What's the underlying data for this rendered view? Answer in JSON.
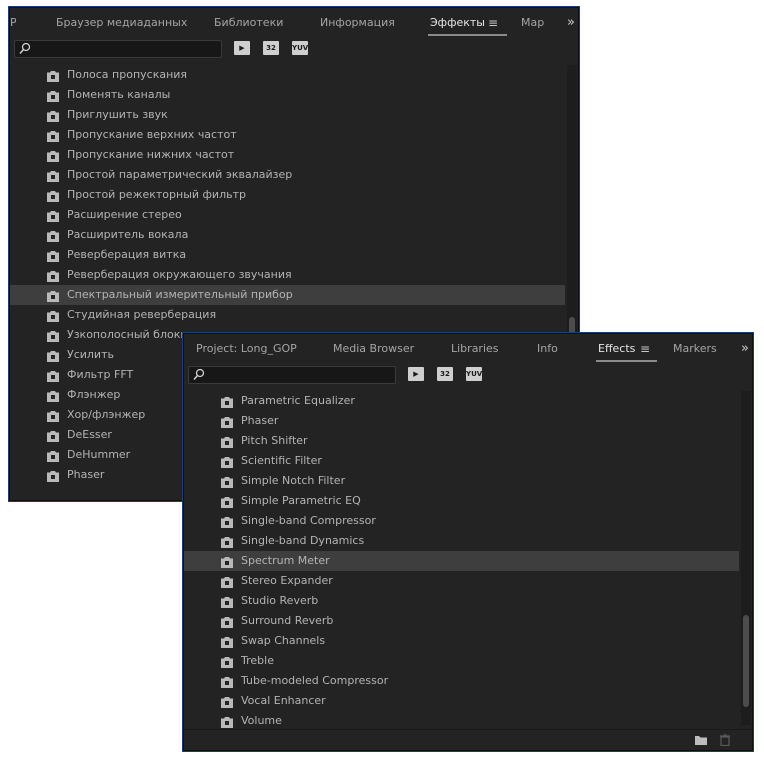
{
  "ru_panel": {
    "tabs": [
      {
        "label": "Браузер медиаданных"
      },
      {
        "label": "Библиотеки"
      },
      {
        "label": "Информация"
      },
      {
        "label": "Эффекты"
      },
      {
        "label": "Мар"
      }
    ],
    "menu_glyph": "≡",
    "overflow_glyph": "»",
    "left_clip": "Р",
    "toolbar": {
      "icon1": "▶",
      "icon2": "32",
      "icon3": "YUV",
      "search_value": "",
      "search_placeholder": ""
    },
    "items": [
      "Полоса пропускания",
      "Поменять каналы",
      "Приглушить звук",
      "Пропускание верхних частот",
      "Пропускание нижних частот",
      "Простой параметрический эквалайзер",
      "Простой режекторный фильтр",
      "Расширение стерео",
      "Расширитель вокала",
      "Реверберация витка",
      "Реверберация окружающего звучания",
      "Спектральный измерительный прибор",
      "Студийная реверберация",
      "Узкополосный блокиратор",
      "Усилить",
      "Фильтр FFT",
      "Флэнжер",
      "Хор/флэнжер",
      "DeEsser",
      "DeHummer",
      "Phaser"
    ],
    "selected_index": 11
  },
  "en_panel": {
    "tabs": [
      {
        "label": "Project: Long_GOP"
      },
      {
        "label": "Media Browser"
      },
      {
        "label": "Libraries"
      },
      {
        "label": "Info"
      },
      {
        "label": "Effects"
      },
      {
        "label": "Markers"
      }
    ],
    "menu_glyph": "≡",
    "overflow_glyph": "»",
    "toolbar": {
      "icon1": "▶",
      "icon2": "32",
      "icon3": "YUV",
      "search_value": "",
      "search_placeholder": ""
    },
    "items": [
      "Parametric Equalizer",
      "Phaser",
      "Pitch Shifter",
      "Scientific Filter",
      "Simple Notch Filter",
      "Simple Parametric EQ",
      "Single-band Compressor",
      "Single-band Dynamics",
      "Spectrum Meter",
      "Stereo Expander",
      "Studio Reverb",
      "Surround Reverb",
      "Swap Channels",
      "Treble",
      "Tube-modeled Compressor",
      "Vocal Enhancer",
      "Volume"
    ],
    "selected_index": 8
  },
  "icons": {
    "item": "audio-effect-icon",
    "search": "search-icon",
    "new_bin": "folder-icon",
    "delete": "trash-icon"
  },
  "colors": {
    "panel_bg": "#232323",
    "selected_row": "#3e3e3e",
    "panel_border": "#1c3f72",
    "text": "#b4b4b4",
    "active_tab": "#e6e6e6"
  }
}
